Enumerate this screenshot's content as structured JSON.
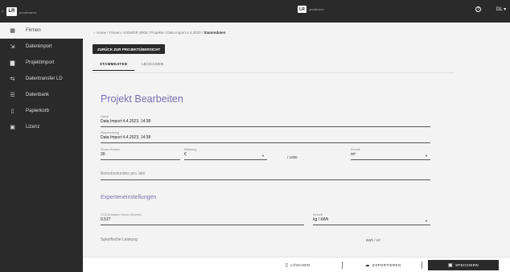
{
  "sidebar": {
    "logo": "LR",
    "logo_sub": "proclimance",
    "items": [
      {
        "icon": "building-icon",
        "glyph": "▦",
        "label": "Firmen",
        "active": true
      },
      {
        "icon": "import-icon",
        "glyph": "⇲",
        "label": "Datenimport",
        "active": false
      },
      {
        "icon": "briefcase-icon",
        "glyph": "▆",
        "label": "Projektimport",
        "active": false
      },
      {
        "icon": "transfer-icon",
        "glyph": "⇆",
        "label": "Datentransfer LD",
        "active": false
      },
      {
        "icon": "list-icon",
        "glyph": "☰",
        "label": "Datenbank",
        "active": false
      },
      {
        "icon": "trash-icon",
        "glyph": "▯",
        "label": "Papierkorb",
        "active": false
      },
      {
        "icon": "license-icon",
        "glyph": "▣",
        "label": "Lizenz",
        "active": false
      }
    ]
  },
  "topbar": {
    "logo": "LR",
    "logo_sub": "proclimance",
    "help": "?",
    "user": "DL ▾"
  },
  "breadcrumb": {
    "home": "Home",
    "items": [
      "Firmen",
      "KIOMOR WKB",
      "Projekte",
      "Data Import 4.4.2023"
    ],
    "current": "Stammdaten",
    "separator": " / "
  },
  "back_button": "ZURÜCK ZUR PROJEKTÜBERSICHT",
  "tabs": [
    "STAMMDATEN",
    "LECKAGEN"
  ],
  "page_title": "Projekt Bearbeiten",
  "form": {
    "name_label": "Name",
    "name_value": "Data Import 4.4.2023, 14:38",
    "desc_label": "Beschreibung",
    "desc_value": "Data Import 4.4.2023, 14:38",
    "price_label": "Strom-/Kosten",
    "price_value": "30",
    "currency_label": "Währung",
    "currency_value": "€",
    "per_unit": "/ 1000",
    "unit_label": "Einheit",
    "unit_value": "m³",
    "hours_placeholder": "Betriebsstunden pro Jahr"
  },
  "expert": {
    "title": "Experteneinstellungen",
    "co2_label": "CO2-Emission Strom (Einheit)",
    "co2_value": "0.527",
    "co2_unit_label": "Einheit",
    "co2_unit_value": "kg / kWh",
    "spec_label": "Spezifische Leistung",
    "spec_unit": "kWh / m³"
  },
  "actions": {
    "delete": "LÖSCHEN",
    "export": "EXPORTIEREN",
    "save": "SPEICHERN"
  }
}
